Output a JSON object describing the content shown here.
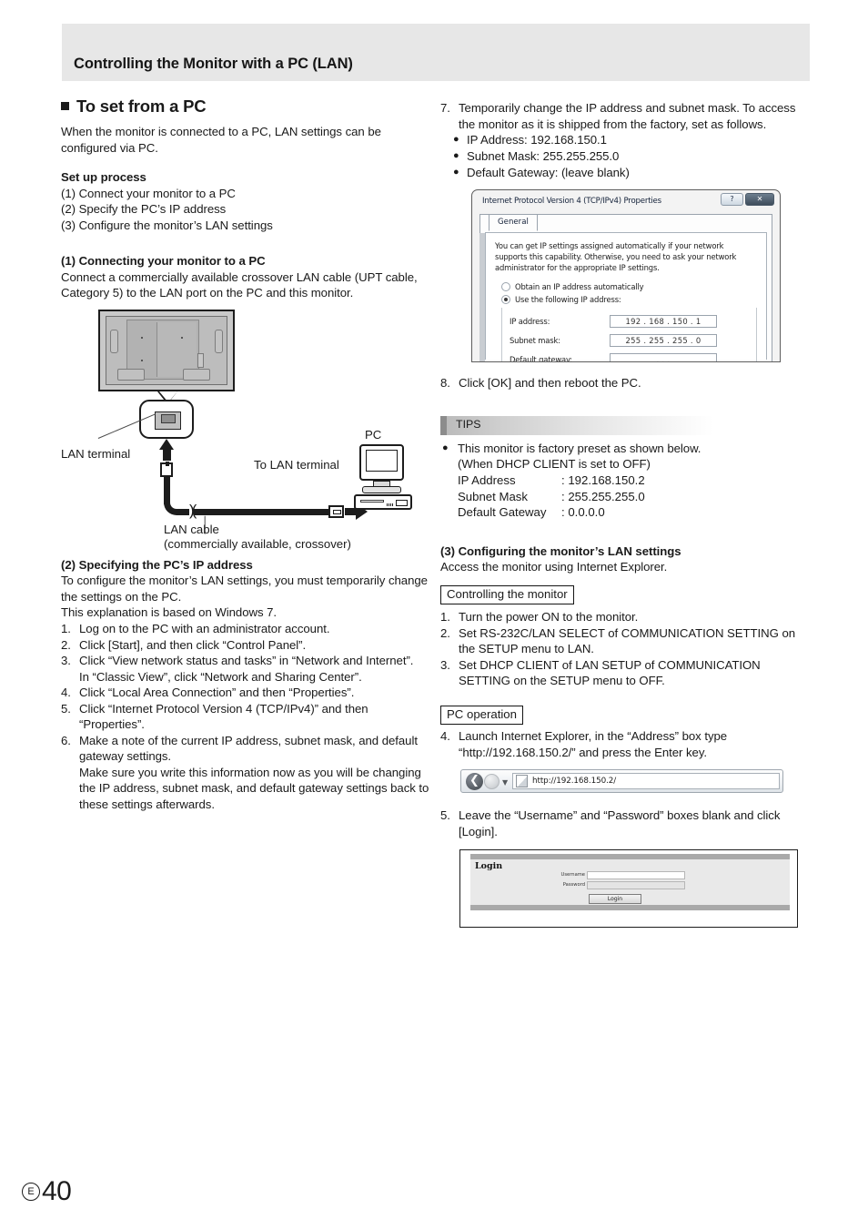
{
  "header": {
    "title": "Controlling the Monitor with a PC (LAN)"
  },
  "left": {
    "section_title": "To set from a PC",
    "intro": "When the monitor is connected to a PC, LAN settings can be configured via PC.",
    "setup_heading": "Set up process",
    "setup_steps": [
      "(1) Connect your monitor to a PC",
      "(2) Specify the PC’s IP address",
      "(3) Configure the monitor’s LAN settings"
    ],
    "step1_heading": "(1) Connecting your monitor to a PC",
    "step1_body": "Connect a commercially available crossover LAN cable (UPT cable, Category 5) to the LAN  port on the PC and this monitor.",
    "diagram": {
      "lan_terminal_label": "LAN terminal",
      "to_lan_terminal_label": "To LAN terminal",
      "pc_label": "PC",
      "lan_cable_label": "LAN cable",
      "lan_cable_sub": "(commercially available, crossover)"
    },
    "step2_heading": "(2) Specifying the PC’s IP address",
    "step2_body1": "To configure the monitor’s LAN settings, you must temporarily change the settings on the PC.",
    "step2_body2": "This explanation is based on Windows 7.",
    "step2_items": [
      {
        "num": "1.",
        "text": "Log on to the PC with an administrator account."
      },
      {
        "num": "2.",
        "text": "Click [Start], and then click “Control Panel”."
      },
      {
        "num": "3.",
        "text": "Click “View network status and tasks” in “Network and Internet”."
      },
      {
        "num": "",
        "text": "In “Classic View”, click “Network and Sharing Center”."
      },
      {
        "num": "4.",
        "text": "Click “Local Area Connection” and then “Properties”."
      },
      {
        "num": "5.",
        "text": "Click “Internet Protocol Version 4 (TCP/IPv4)” and then “Properties”."
      },
      {
        "num": "6.",
        "text": "Make a note of the current IP address, subnet mask, and default gateway settings."
      },
      {
        "num": "",
        "text": "Make sure you write this information now as you will be changing the IP address, subnet mask, and default gateway settings back to these settings afterwards."
      }
    ]
  },
  "right": {
    "step7_num": "7.",
    "step7_text": "Temporarily change the IP address and subnet mask. To access the monitor as it is shipped from the factory, set as follows.",
    "step7_bullets": [
      "IP Address: 192.168.150.1",
      "Subnet Mask: 255.255.255.0",
      "Default Gateway: (leave blank)"
    ],
    "dialog": {
      "title": "Internet Protocol Version 4 (TCP/IPv4) Properties",
      "help_button": "?",
      "close_button": "✕",
      "tab": "General",
      "description": "You can get IP settings assigned automatically if your network supports this capability. Otherwise, you need to ask your network administrator for the appropriate IP settings.",
      "radio_auto": "Obtain an IP address automatically",
      "radio_manual": "Use the following IP address:",
      "fields": [
        {
          "label": "IP address:",
          "value": "192 . 168 . 150 .  1"
        },
        {
          "label": "Subnet mask:",
          "value": "255 . 255 . 255 .  0"
        },
        {
          "label": "Default gateway:",
          "value": ".     .     ."
        }
      ]
    },
    "step8_num": "8.",
    "step8_text": "Click [OK] and then reboot the PC.",
    "tips": {
      "label": "TIPS",
      "bullet": "This monitor is factory preset as shown below.",
      "line2": "(When DHCP CLIENT is set to OFF)",
      "rows": [
        {
          "name": "IP Address",
          "value": ": 192.168.150.2"
        },
        {
          "name": "Subnet Mask",
          "value": ": 255.255.255.0"
        },
        {
          "name": "Default Gateway",
          "value": ": 0.0.0.0"
        }
      ]
    },
    "step3_heading": "(3) Configuring the monitor’s LAN settings",
    "step3_body": "Access the monitor using Internet Explorer.",
    "controlling_label": "Controlling the monitor",
    "controlling_items": [
      {
        "num": "1.",
        "text": "Turn the power ON to the monitor."
      },
      {
        "num": "2.",
        "text": "Set RS-232C/LAN SELECT of COMMUNICATION SETTING on the SETUP menu to LAN."
      },
      {
        "num": "3.",
        "text": "Set DHCP CLIENT of LAN SETUP of COMMUNICATION SETTING on the SETUP menu to OFF."
      }
    ],
    "pc_operation_label": "PC operation",
    "pc_items": [
      {
        "num": "4.",
        "text": "Launch Internet Explorer, in the “Address” box type “http://192.168.150.2/” and press the Enter key."
      }
    ],
    "ie": {
      "back_icon": "back-arrow-icon",
      "url": "http://192.168.150.2/"
    },
    "pc_items2": [
      {
        "num": "5.",
        "text": "Leave the “Username” and “Password” boxes blank and click [Login]."
      }
    ],
    "login": {
      "heading": "Login",
      "username_label": "Username",
      "password_label": "Password",
      "button": "Login"
    }
  },
  "footer": {
    "mark": "E",
    "page": "40"
  }
}
